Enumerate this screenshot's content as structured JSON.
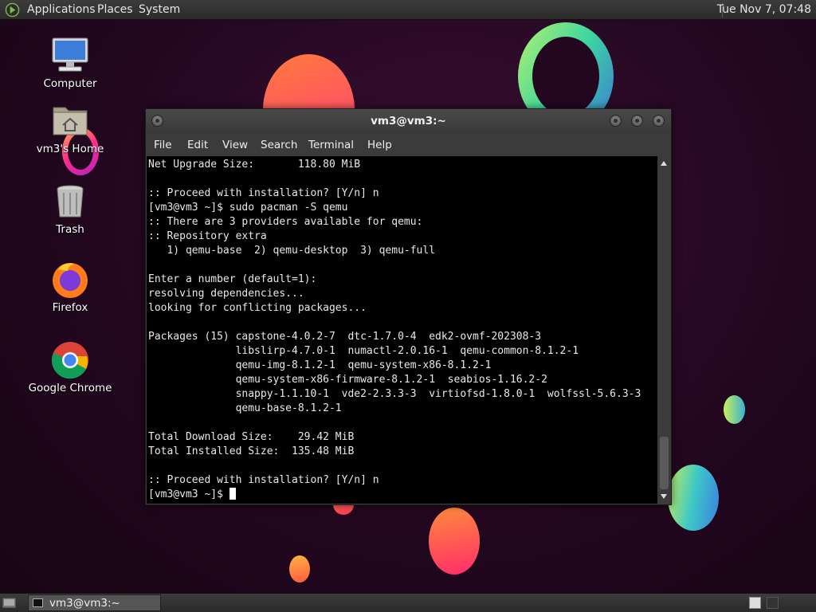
{
  "top_panel": {
    "menus": [
      "Applications",
      "Places",
      "System"
    ],
    "clock": "Tue Nov 7, 07:48"
  },
  "desktop_icons": [
    {
      "label": "Computer",
      "icon": "computer-icon"
    },
    {
      "label": "vm3's Home",
      "icon": "home-folder-icon"
    },
    {
      "label": "Trash",
      "icon": "trash-icon"
    },
    {
      "label": "Firefox",
      "icon": "firefox-icon"
    },
    {
      "label": "Google Chrome",
      "icon": "chrome-icon"
    }
  ],
  "terminal": {
    "title": "vm3@vm3:~",
    "menu": [
      "File",
      "Edit",
      "View",
      "Search",
      "Terminal",
      "Help"
    ],
    "lines": [
      "Net Upgrade Size:       118.80 MiB",
      "",
      ":: Proceed with installation? [Y/n] n",
      "[vm3@vm3 ~]$ sudo pacman -S qemu",
      ":: There are 3 providers available for qemu:",
      ":: Repository extra",
      "   1) qemu-base  2) qemu-desktop  3) qemu-full",
      "",
      "Enter a number (default=1):",
      "resolving dependencies...",
      "looking for conflicting packages...",
      "",
      "Packages (15) capstone-4.0.2-7  dtc-1.7.0-4  edk2-ovmf-202308-3",
      "              libslirp-4.7.0-1  numactl-2.0.16-1  qemu-common-8.1.2-1",
      "              qemu-img-8.1.2-1  qemu-system-x86-8.1.2-1",
      "              qemu-system-x86-firmware-8.1.2-1  seabios-1.16.2-2",
      "              snappy-1.1.10-1  vde2-2.3.3-3  virtiofsd-1.8.0-1  wolfssl-5.6.3-3",
      "              qemu-base-8.1.2-1",
      "",
      "Total Download Size:    29.42 MiB",
      "Total Installed Size:  135.48 MiB",
      "",
      ":: Proceed with installation? [Y/n] n"
    ],
    "prompt": "[vm3@vm3 ~]$ "
  },
  "taskbar": {
    "tasks": [
      {
        "label": "vm3@vm3:~",
        "icon": "terminal-icon"
      }
    ]
  }
}
